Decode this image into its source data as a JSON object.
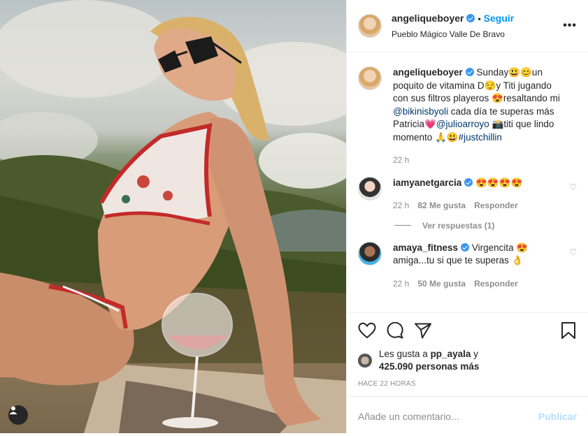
{
  "post": {
    "username": "angeliqueboyer",
    "follow_label": "Seguir",
    "location": "Pueblo Mágico Valle De Bravo",
    "more_label": "•••"
  },
  "caption": {
    "username": "angeliqueboyer",
    "text_1": " Sunday😃😊un poquito de vitamina D😌y Titi jugando con sus filtros playeros 😍resaltando mi ",
    "mention_1": "@bikinisbyoli",
    "text_2": " cada día te superas más Patricia💗",
    "mention_2": "@julioarroyo",
    "text_3": " 📸titi que lindo momento 🙏😃",
    "hashtag": "#justchillin",
    "time": "22 h"
  },
  "comments": [
    {
      "username": "iamyanetgarcia",
      "text": " 😍😍😍😍",
      "time": "22 h",
      "likes": "82 Me gusta",
      "reply": "Responder",
      "view_replies": "Ver respuestas (1)"
    },
    {
      "username": "amaya_fitness",
      "text": " Virgencita 😍 amiga...tu si que te superas 👌",
      "time": "22 h",
      "likes": "50 Me gusta",
      "reply": "Responder"
    }
  ],
  "likes": {
    "prefix": "Les gusta a ",
    "user": "pp_ayala",
    "middle": " y",
    "count": "425.090 personas más"
  },
  "timestamp": "HACE 22 HORAS",
  "add_comment": {
    "placeholder": "Añade un comentario...",
    "publish_label": "Publicar"
  },
  "colors": {
    "accent": "#0095f6",
    "verified": "#3897f0",
    "mention": "#00376b",
    "muted": "#8e8e8e",
    "publish_disabled": "#b2dffc"
  },
  "icons": [
    "heart-icon",
    "comment-icon",
    "share-icon",
    "bookmark-icon",
    "user-icon",
    "verified-icon"
  ]
}
